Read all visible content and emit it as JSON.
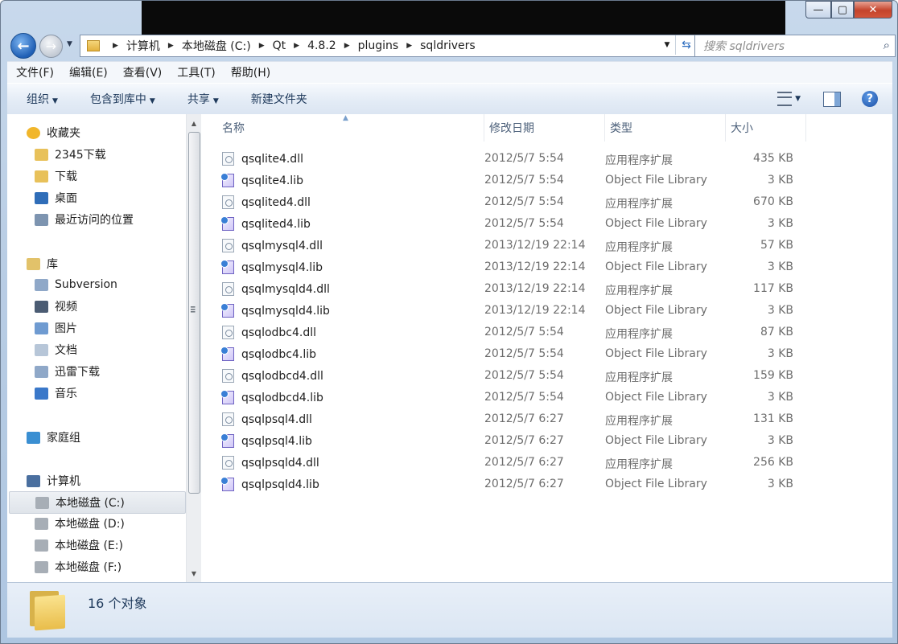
{
  "window": {
    "caption": {
      "minimize": "—",
      "maximize": "▢",
      "close": "✕"
    }
  },
  "nav": {
    "back": "←",
    "forward": "→",
    "dropdown": "▼"
  },
  "address": {
    "crumbs": [
      "计算机",
      "本地磁盘 (C:)",
      "Qt",
      "4.8.2",
      "plugins",
      "sqldrivers"
    ],
    "separator": "▶",
    "dropdown": "▼",
    "refresh": "⇆"
  },
  "search": {
    "placeholder": "搜索 sqldrivers",
    "icon": "search-icon"
  },
  "menu": [
    "文件(F)",
    "编辑(E)",
    "查看(V)",
    "工具(T)",
    "帮助(H)"
  ],
  "toolbar": {
    "organize": "组织",
    "include_library": "包含到库中",
    "share": "共享",
    "new_folder": "新建文件夹",
    "arrow": "▼",
    "help": "?"
  },
  "sidebar": [
    {
      "label": "收藏夹",
      "icon": "star-icon",
      "group": true
    },
    {
      "label": "2345下载",
      "icon": "folder-icon"
    },
    {
      "label": "下载",
      "icon": "folder-icon"
    },
    {
      "label": "桌面",
      "icon": "desktop-icon"
    },
    {
      "label": "最近访问的位置",
      "icon": "recent-places-icon"
    },
    {
      "label": "库",
      "icon": "library-icon",
      "group": true
    },
    {
      "label": "Subversion",
      "icon": "library-item-icon"
    },
    {
      "label": "视频",
      "icon": "video-icon"
    },
    {
      "label": "图片",
      "icon": "picture-icon"
    },
    {
      "label": "文档",
      "icon": "document-icon"
    },
    {
      "label": "迅雷下载",
      "icon": "library-item-icon"
    },
    {
      "label": "音乐",
      "icon": "music-icon"
    },
    {
      "label": "家庭组",
      "icon": "homegroup-icon",
      "group": true
    },
    {
      "label": "计算机",
      "icon": "computer-icon",
      "group": true
    },
    {
      "label": "本地磁盘 (C:)",
      "icon": "drive-icon",
      "selected": true
    },
    {
      "label": "本地磁盘 (D:)",
      "icon": "drive-icon"
    },
    {
      "label": "本地磁盘 (E:)",
      "icon": "drive-icon"
    },
    {
      "label": "本地磁盘 (F:)",
      "icon": "drive-icon"
    }
  ],
  "columns": {
    "name": "名称",
    "modified": "修改日期",
    "type": "类型",
    "size": "大小"
  },
  "files": [
    {
      "name": "qsqlite4.dll",
      "date": "2012/5/7 5:54",
      "type": "应用程序扩展",
      "size": "435 KB",
      "kind": "dll"
    },
    {
      "name": "qsqlite4.lib",
      "date": "2012/5/7 5:54",
      "type": "Object File Library",
      "size": "3 KB",
      "kind": "lib"
    },
    {
      "name": "qsqlited4.dll",
      "date": "2012/5/7 5:54",
      "type": "应用程序扩展",
      "size": "670 KB",
      "kind": "dll"
    },
    {
      "name": "qsqlited4.lib",
      "date": "2012/5/7 5:54",
      "type": "Object File Library",
      "size": "3 KB",
      "kind": "lib"
    },
    {
      "name": "qsqlmysql4.dll",
      "date": "2013/12/19 22:14",
      "type": "应用程序扩展",
      "size": "57 KB",
      "kind": "dll"
    },
    {
      "name": "qsqlmysql4.lib",
      "date": "2013/12/19 22:14",
      "type": "Object File Library",
      "size": "3 KB",
      "kind": "lib"
    },
    {
      "name": "qsqlmysqld4.dll",
      "date": "2013/12/19 22:14",
      "type": "应用程序扩展",
      "size": "117 KB",
      "kind": "dll"
    },
    {
      "name": "qsqlmysqld4.lib",
      "date": "2013/12/19 22:14",
      "type": "Object File Library",
      "size": "3 KB",
      "kind": "lib"
    },
    {
      "name": "qsqlodbc4.dll",
      "date": "2012/5/7 5:54",
      "type": "应用程序扩展",
      "size": "87 KB",
      "kind": "dll"
    },
    {
      "name": "qsqlodbc4.lib",
      "date": "2012/5/7 5:54",
      "type": "Object File Library",
      "size": "3 KB",
      "kind": "lib"
    },
    {
      "name": "qsqlodbcd4.dll",
      "date": "2012/5/7 5:54",
      "type": "应用程序扩展",
      "size": "159 KB",
      "kind": "dll"
    },
    {
      "name": "qsqlodbcd4.lib",
      "date": "2012/5/7 5:54",
      "type": "Object File Library",
      "size": "3 KB",
      "kind": "lib"
    },
    {
      "name": "qsqlpsql4.dll",
      "date": "2012/5/7 6:27",
      "type": "应用程序扩展",
      "size": "131 KB",
      "kind": "dll"
    },
    {
      "name": "qsqlpsql4.lib",
      "date": "2012/5/7 6:27",
      "type": "Object File Library",
      "size": "3 KB",
      "kind": "lib"
    },
    {
      "name": "qsqlpsqld4.dll",
      "date": "2012/5/7 6:27",
      "type": "应用程序扩展",
      "size": "256 KB",
      "kind": "dll"
    },
    {
      "name": "qsqlpsqld4.lib",
      "date": "2012/5/7 6:27",
      "type": "Object File Library",
      "size": "3 KB",
      "kind": "lib"
    }
  ],
  "status": {
    "count": "16 个对象"
  }
}
